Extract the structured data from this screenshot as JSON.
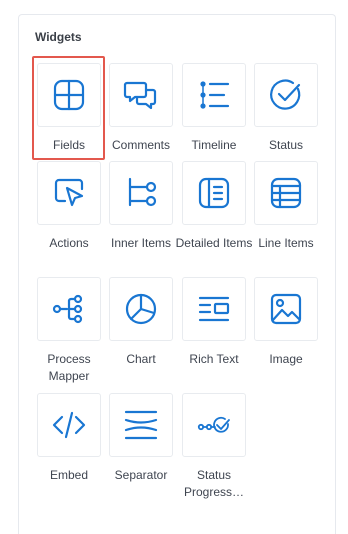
{
  "panel": {
    "title": "Widgets"
  },
  "accent_color": "#1976d2",
  "highlight_color": "#e3584d",
  "widgets": [
    {
      "label": "Fields",
      "icon": "fields-icon",
      "selected": true
    },
    {
      "label": "Comments",
      "icon": "comments-icon"
    },
    {
      "label": "Timeline",
      "icon": "timeline-icon"
    },
    {
      "label": "Status",
      "icon": "status-icon"
    },
    {
      "label": "Actions",
      "icon": "actions-icon"
    },
    {
      "label": "Inner Items",
      "icon": "inner-items-icon"
    },
    {
      "label": "Detailed Items",
      "icon": "detailed-items-icon"
    },
    {
      "label": "Line Items",
      "icon": "line-items-icon"
    },
    {
      "label": "Process Mapper",
      "icon": "process-mapper-icon"
    },
    {
      "label": "Chart",
      "icon": "chart-icon"
    },
    {
      "label": "Rich Text",
      "icon": "rich-text-icon"
    },
    {
      "label": "Image",
      "icon": "image-icon"
    },
    {
      "label": "Embed",
      "icon": "embed-icon"
    },
    {
      "label": "Separator",
      "icon": "separator-icon"
    },
    {
      "label": "Status Progress…",
      "icon": "status-progress-icon"
    }
  ]
}
